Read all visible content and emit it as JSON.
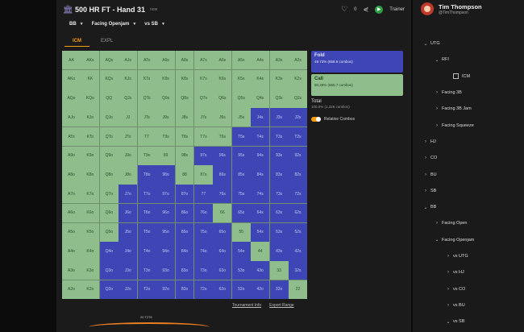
{
  "header": {
    "title": "500 HR FT - Hand 31",
    "subtitle": "now",
    "like_count": "0",
    "trainer_label": "Trainer"
  },
  "selectors": [
    {
      "label": "BB"
    },
    {
      "label": "Facing Openjam"
    },
    {
      "label": "vs SB"
    }
  ],
  "tabs": [
    "ICM",
    "EXPL"
  ],
  "range_grid": {
    "rows": [
      [
        "AA",
        "AKs",
        "AQs",
        "AJs",
        "ATs",
        "A9s",
        "A8s",
        "A7s",
        "A6s",
        "A5s",
        "A4s",
        "A3s",
        "A2s"
      ],
      [
        "AKo",
        "KK",
        "KQs",
        "KJs",
        "KTs",
        "K9s",
        "K8s",
        "K7s",
        "K6s",
        "K5s",
        "K4s",
        "K3s",
        "K2s"
      ],
      [
        "AQo",
        "KQo",
        "QQ",
        "QJs",
        "QTs",
        "Q9s",
        "Q8s",
        "Q7s",
        "Q6s",
        "Q5s",
        "Q4s",
        "Q3s",
        "Q2s"
      ],
      [
        "AJo",
        "KJo",
        "QJo",
        "JJ",
        "JTs",
        "J9s",
        "J8s",
        "J7s",
        "J6s",
        "J5s",
        "J4s",
        "J3s",
        "J2s"
      ],
      [
        "ATo",
        "KTo",
        "QTo",
        "JTo",
        "TT",
        "T9s",
        "T8s",
        "T7s",
        "T6s",
        "T5s",
        "T4s",
        "T3s",
        "T2s"
      ],
      [
        "A9o",
        "K9o",
        "Q9o",
        "J9o",
        "T9o",
        "99",
        "98s",
        "97s",
        "96s",
        "95s",
        "94s",
        "93s",
        "92s"
      ],
      [
        "A8o",
        "K8o",
        "Q8o",
        "J8o",
        "T8o",
        "98o",
        "88",
        "87s",
        "86s",
        "85s",
        "84s",
        "83s",
        "82s"
      ],
      [
        "A7o",
        "K7o",
        "Q7o",
        "J7o",
        "T7o",
        "97o",
        "87o",
        "77",
        "76s",
        "75s",
        "74s",
        "73s",
        "72s"
      ],
      [
        "A6o",
        "K6o",
        "Q6o",
        "J6o",
        "T6o",
        "96o",
        "86o",
        "76o",
        "66",
        "65s",
        "64s",
        "63s",
        "62s"
      ],
      [
        "A5o",
        "K5o",
        "Q5o",
        "J5o",
        "T5o",
        "95o",
        "85o",
        "75o",
        "65o",
        "55",
        "54s",
        "53s",
        "52s"
      ],
      [
        "A4o",
        "K4o",
        "Q4o",
        "J4o",
        "T4o",
        "94o",
        "84o",
        "74o",
        "64o",
        "54o",
        "44",
        "43s",
        "42s"
      ],
      [
        "A3o",
        "K3o",
        "Q3o",
        "J3o",
        "T3o",
        "93o",
        "83o",
        "73o",
        "63o",
        "53o",
        "43o",
        "33",
        "32s"
      ],
      [
        "A2o",
        "K2o",
        "Q2o",
        "J2o",
        "T2o",
        "92o",
        "82o",
        "72o",
        "62o",
        "52o",
        "42o",
        "32o",
        "22"
      ]
    ],
    "call_counts": [
      0,
      0,
      0,
      0,
      0,
      0,
      0,
      0,
      0,
      0,
      0,
      0,
      0
    ],
    "fold_cells": [
      "J4s",
      "J3s",
      "J2s",
      "76s",
      "T5s",
      "T4s",
      "T3s",
      "T2s",
      "97s",
      "96s",
      "95s",
      "94s",
      "93s",
      "92s",
      "T8o",
      "98o",
      "86s",
      "85s",
      "84s",
      "83s",
      "82s",
      "J7o",
      "T7o",
      "97o",
      "87o",
      "77",
      "76s",
      "75s",
      "74s",
      "73s",
      "72s",
      "J6o",
      "T6o",
      "96o",
      "86o",
      "76o",
      "65s",
      "64s",
      "63s",
      "62s",
      "J5o",
      "T5o",
      "95o",
      "85o",
      "75o",
      "65o",
      "54s",
      "53s",
      "52s",
      "Q4o",
      "J4o",
      "T4o",
      "94o",
      "84o",
      "74o",
      "64o",
      "54o",
      "43s",
      "42s",
      "Q3o",
      "J3o",
      "T3o",
      "93o",
      "83o",
      "73o",
      "63o",
      "53o",
      "43o",
      "32s",
      "Q2o",
      "J2o",
      "T2o",
      "92o",
      "82o",
      "72o",
      "62o",
      "52o",
      "42o",
      "32o"
    ]
  },
  "legend": {
    "fold_label": "Fold",
    "fold_pct": "49.73% (659.5 combos)",
    "call_label": "Call",
    "call_pct": "50.28% (665.7 combos)",
    "total_label": "Total",
    "total_sub": "100.0% (1,326 combos)",
    "toggle_label": "Relative Combos"
  },
  "footer": {
    "tournament_info": "Tournament Info",
    "export_range": "Export Range",
    "bottom_chip": "20 T275"
  },
  "profile": {
    "name": "Tim Thompson",
    "handle": "@TimThompson"
  },
  "tree": [
    {
      "label": "UTG",
      "chev": "⌄",
      "indent": 0
    },
    {
      "label": "RFI",
      "chev": "⌄",
      "indent": 1
    },
    {
      "label": "ICM",
      "chev": "",
      "indent": 2,
      "icon": "grid"
    },
    {
      "label": "Facing 3B",
      "chev": "›",
      "indent": 1
    },
    {
      "label": "Facing 3B Jam",
      "chev": "›",
      "indent": 1
    },
    {
      "label": "Facing Squeeze",
      "chev": "›",
      "indent": 1
    },
    {
      "label": "HJ",
      "chev": "›",
      "indent": 0
    },
    {
      "label": "CO",
      "chev": "›",
      "indent": 0
    },
    {
      "label": "BU",
      "chev": "›",
      "indent": 0
    },
    {
      "label": "SB",
      "chev": "›",
      "indent": 0
    },
    {
      "label": "BB",
      "chev": "⌄",
      "indent": 0
    },
    {
      "label": "Facing Open",
      "chev": "›",
      "indent": 1
    },
    {
      "label": "Facing Openjam",
      "chev": "⌄",
      "indent": 1
    },
    {
      "label": "vs UTG",
      "chev": "›",
      "indent": 2
    },
    {
      "label": "vs HJ",
      "chev": "›",
      "indent": 2
    },
    {
      "label": "vs CO",
      "chev": "›",
      "indent": 2
    },
    {
      "label": "vs BU",
      "chev": "›",
      "indent": 2
    },
    {
      "label": "vs SB",
      "chev": "⌄",
      "indent": 2
    }
  ]
}
